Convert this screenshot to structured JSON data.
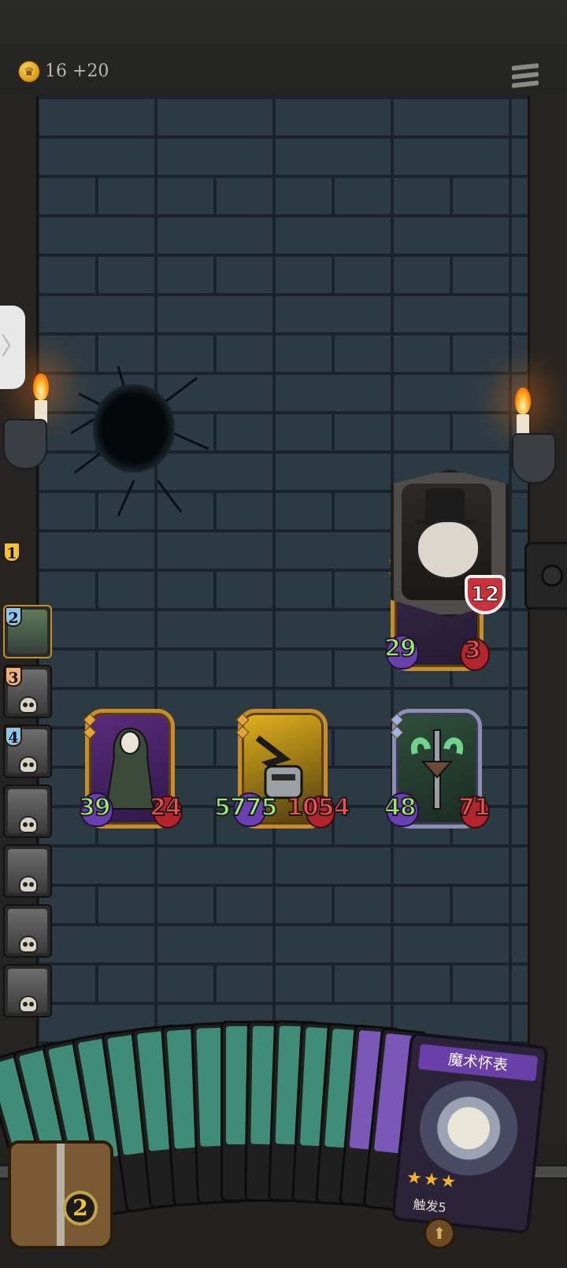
{
  "header": {
    "gold_icon": "crown-coin-icon",
    "gold_amount": "16",
    "gold_income": "+20",
    "menu_icon": "menu-icon"
  },
  "side_tab": {
    "icon": "chevron-right-icon",
    "glyph": "〉"
  },
  "turn_order": [
    {
      "number": "1",
      "badge_color": "#f2c230"
    },
    {
      "number": "2",
      "badge_color": "#8fc4ef"
    },
    {
      "number": "3",
      "badge_color": "#efb080"
    },
    {
      "number": "4",
      "badge_color": "#8fc4ef"
    },
    {
      "number": ""
    },
    {
      "number": ""
    },
    {
      "number": ""
    },
    {
      "number": ""
    }
  ],
  "boss": {
    "name_icon": "top-hat-magician-boss",
    "health": "12",
    "attack": "29",
    "hp": "3"
  },
  "allies": [
    {
      "name": "reaper-unit",
      "attack": "39",
      "hp": "24"
    },
    {
      "name": "robot-unit",
      "attack": "5775",
      "hp": "1054"
    },
    {
      "name": "sword-plant-unit",
      "attack": "48",
      "hp": "71"
    }
  ],
  "hand": {
    "featured_card": {
      "title": "魔术怀表",
      "stars": "★★★",
      "description": "触发5"
    }
  },
  "deck": {
    "count": "2",
    "icon": "deck-chest-icon"
  },
  "discard": {
    "icon": "discard-pile-icon"
  },
  "colors": {
    "attack": "#9ee876",
    "health": "#ef4f4f",
    "gold_frame": "#c78d2a"
  }
}
